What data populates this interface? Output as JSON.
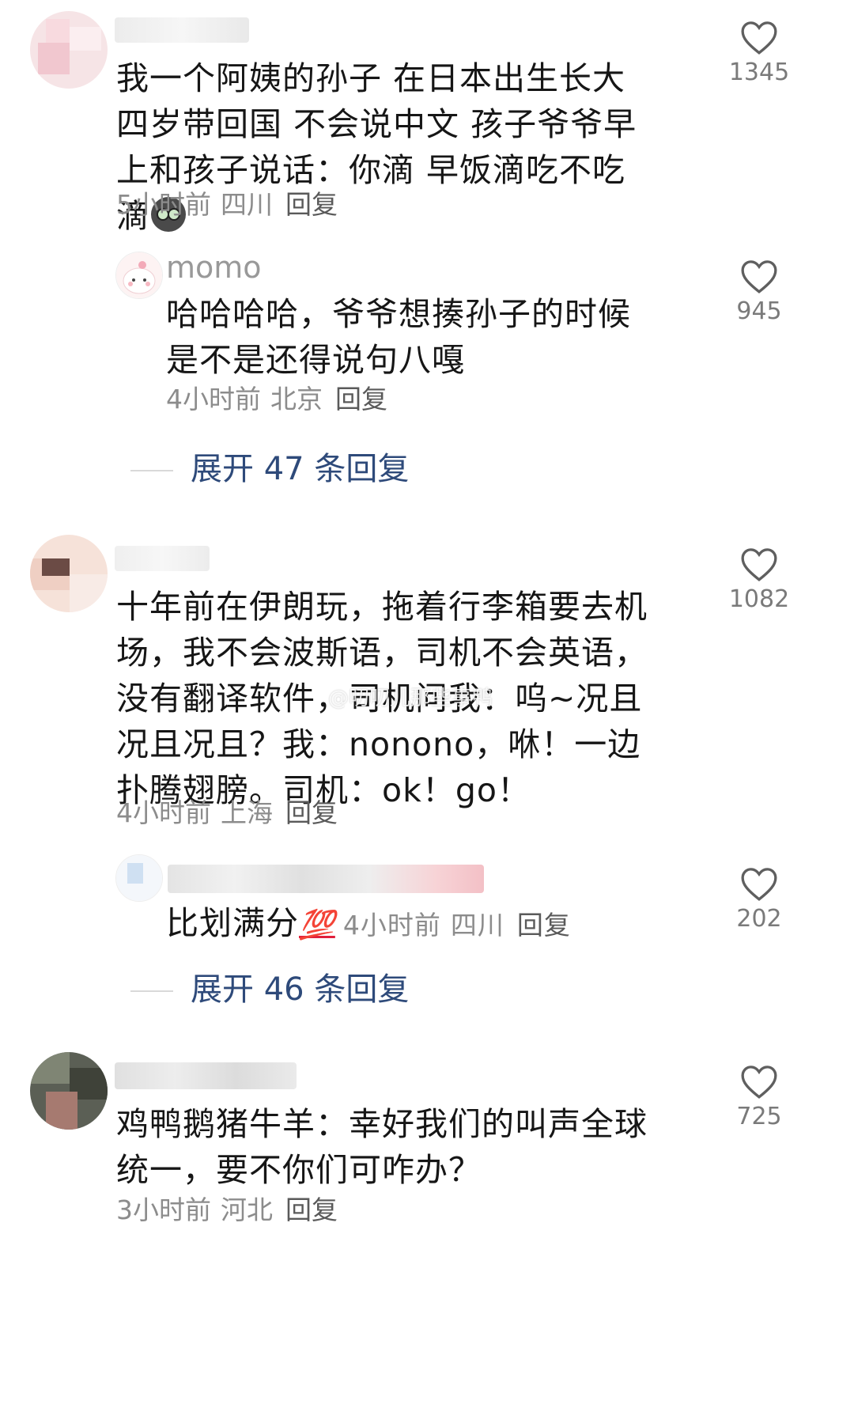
{
  "comments": [
    {
      "text": "我一个阿姨的孙子 在日本出生长大 四岁带回国 不会说中文 孩子爷爷早上和孩子说话：你滴 早饭滴吃不吃滴",
      "time": "5小时前",
      "location": "四川",
      "reply_label": "回复",
      "likes": "1345",
      "reply": {
        "name": "momo",
        "text": "哈哈哈哈，爷爷想揍孙子的时候是不是还得说句八嘎",
        "time": "4小时前",
        "location": "北京",
        "reply_label": "回复",
        "likes": "945"
      },
      "expand_label": "展开 47 条回复"
    },
    {
      "text": "十年前在伊朗玩，拖着行李箱要去机场，我不会波斯语，司机不会英语，没有翻译软件，司机问我：呜~况且况且况且？我：nonono，咻！一边扑腾翅膀。司机：ok！go！",
      "time": "4小时前",
      "location": "上海",
      "reply_label": "回复",
      "likes": "1082",
      "reply": {
        "text": "比划满分",
        "emoji": "💯",
        "time": "4小时前",
        "location": "四川",
        "reply_label": "回复",
        "likes": "202"
      },
      "expand_label": "展开 46 条回复"
    },
    {
      "text": "鸡鸭鹅猪牛羊：幸好我们的叫声全球统一，要不你们可咋办？",
      "time": "3小时前",
      "location": "河北",
      "reply_label": "回复",
      "likes": "725"
    }
  ],
  "watermark": "@叨叨儿那些事鸭",
  "colors": {
    "text": "#161616",
    "meta": "#8c8c8c",
    "expand": "#2e4a7a",
    "icon": "#5f5f5f"
  }
}
